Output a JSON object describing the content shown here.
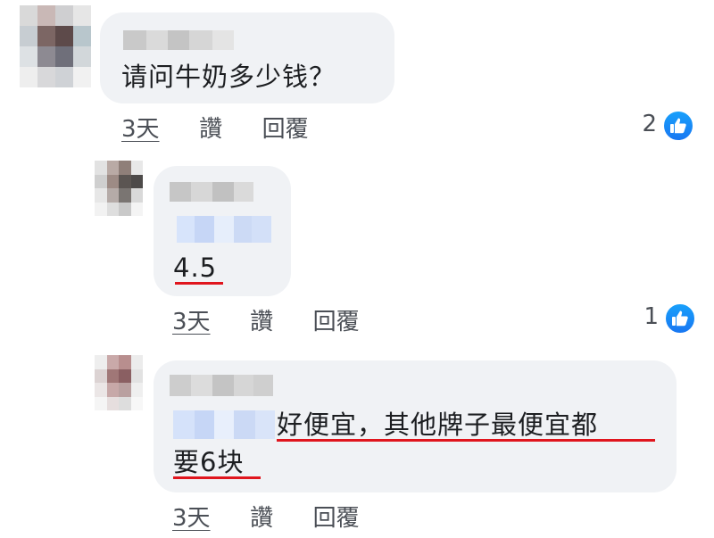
{
  "comments": [
    {
      "text": "请问牛奶多少钱？",
      "time": "3天",
      "like_label": "讚",
      "reply_label": "回覆",
      "reaction_count": "2",
      "reaction_icon": "like-thumb-icon"
    },
    {
      "text": "4.5",
      "time": "3天",
      "like_label": "讚",
      "reply_label": "回覆",
      "reaction_count": "1",
      "reaction_icon": "like-thumb-icon"
    },
    {
      "text_line1": "好便宜，其他牌子最便宜都",
      "text_line2": "要6块",
      "time": "3天",
      "like_label": "讚",
      "reply_label": "回覆"
    }
  ],
  "colors": {
    "bubble": "#f0f2f5",
    "highlight_underline": "#e0151d",
    "like_blue": "#1877f2",
    "meta_text": "#4b4f56"
  }
}
